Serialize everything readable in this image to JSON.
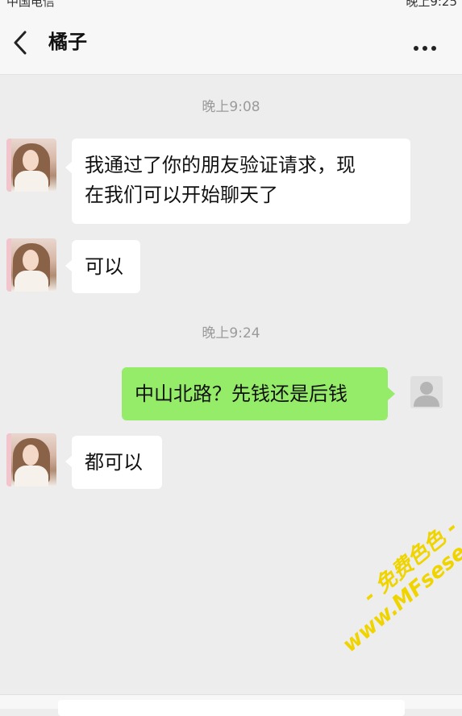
{
  "statusbar": {
    "left_text": "中国电信",
    "right_text": "晚上9:25"
  },
  "header": {
    "title": "橘子",
    "back_icon": "chevron-left-icon",
    "more_icon": "more-dots-icon"
  },
  "chat": {
    "messages": [
      {
        "type": "time",
        "text": "晚上9:08"
      },
      {
        "type": "incoming",
        "lines": [
          "我通过了你的朋友验证请求，现",
          "在我们可以开始聊天了"
        ]
      },
      {
        "type": "incoming",
        "text": "可以"
      },
      {
        "type": "time",
        "text": "晚上9:24"
      },
      {
        "type": "outgoing",
        "text": "中山北路？先钱还是后钱"
      },
      {
        "type": "incoming",
        "text": "都可以"
      }
    ]
  },
  "watermark": {
    "line1": "- 免费色色 -",
    "line2": "www.MFsese.com"
  },
  "colors": {
    "background": "#ededed",
    "outgoing_bubble": "#95ec69",
    "incoming_bubble": "#ffffff",
    "watermark": "#f0d400"
  }
}
